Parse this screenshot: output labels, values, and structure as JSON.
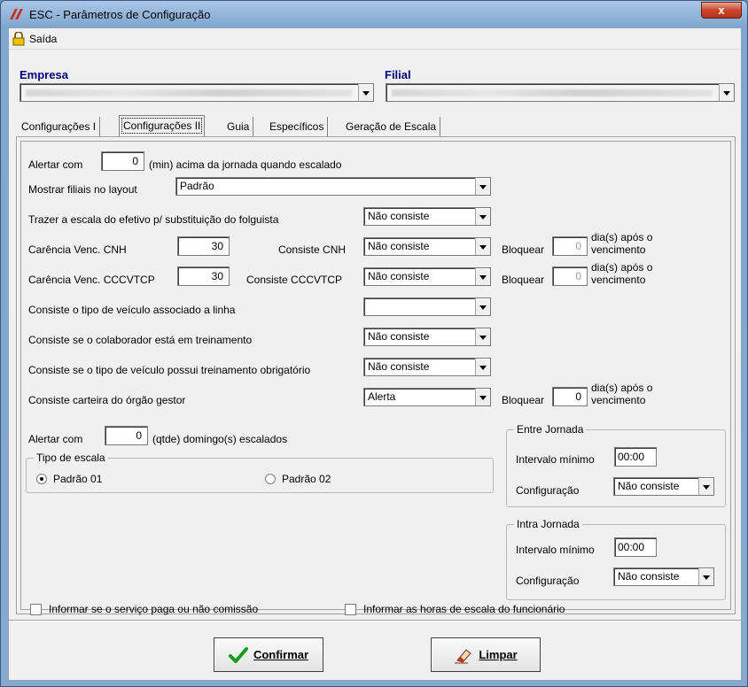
{
  "window": {
    "title": "ESC - Parâmetros de Configuração",
    "close_label": "x"
  },
  "menu": {
    "saida": "Saída"
  },
  "empresa": {
    "label": "Empresa"
  },
  "filial": {
    "label": "Filial"
  },
  "tabs": [
    {
      "label": "Configurações I"
    },
    {
      "label": "Configurações II",
      "active": true
    },
    {
      "label": "Guia"
    },
    {
      "label": "Específicos"
    },
    {
      "label": "Geração de Escala"
    }
  ],
  "form": {
    "alertar_prefix": "Alertar com",
    "alertar_value": "0",
    "alertar_suffix": "(min) acima da jornada quando escalado",
    "mostrar_label": "Mostrar filiais no layout",
    "mostrar_value": "Padrão",
    "trazer_label": "Trazer a escala do efetivo p/ substituição do folguista",
    "trazer_value": "Não consiste",
    "cnh_label": "Carência Venc. CNH",
    "cnh_value": "30",
    "cnh_consiste_label": "Consiste CNH",
    "cnh_consiste_value": "Não consiste",
    "bloquear_label": "Bloquear",
    "cnh_bloquear_value": "0",
    "dias_line1": "dia(s) após o",
    "dias_line2": "vencimento",
    "cccvtcp_label": "Carência Venc. CCCVTCP",
    "cccvtcp_value": "30",
    "cccvtcp_consiste_label": "Consiste CCCVTCP",
    "cccvtcp_consiste_value": "Não consiste",
    "cccvtcp_bloquear_value": "0",
    "veiculo_linha_label": "Consiste o tipo de veículo associado a linha",
    "veiculo_linha_value": "",
    "treinamento_label": "Consiste se o colaborador está em treinamento",
    "treinamento_value": "Não consiste",
    "veiculo_trein_label": "Consiste se o tipo de veículo possui treinamento obrigatório",
    "veiculo_trein_value": "Não consiste",
    "carteira_label": "Consiste carteira do órgão gestor",
    "carteira_value": "Alerta",
    "carteira_bloquear_value": "0",
    "domingo_prefix": "Alertar com",
    "domingo_value": "0",
    "domingo_suffix": "(qtde) domingo(s) escalados",
    "tipo_escala_legend": "Tipo de escala",
    "padrao01": "Padrão 01",
    "padrao02": "Padrão 02",
    "entre_legend": "Entre Jornada",
    "intra_legend": "Intra Jornada",
    "intervalo_label": "Intervalo mínimo",
    "entre_intervalo": "00:00",
    "intra_intervalo": "00:00",
    "configuracao_label": "Configuração",
    "entre_config": "Não consiste",
    "intra_config": "Não consiste",
    "comissao_label": "Informar se o serviço paga ou não comissão",
    "horas_label": "Informar as horas de escala do funcionário"
  },
  "buttons": {
    "confirmar": "Confirmar",
    "limpar": "Limpar"
  }
}
